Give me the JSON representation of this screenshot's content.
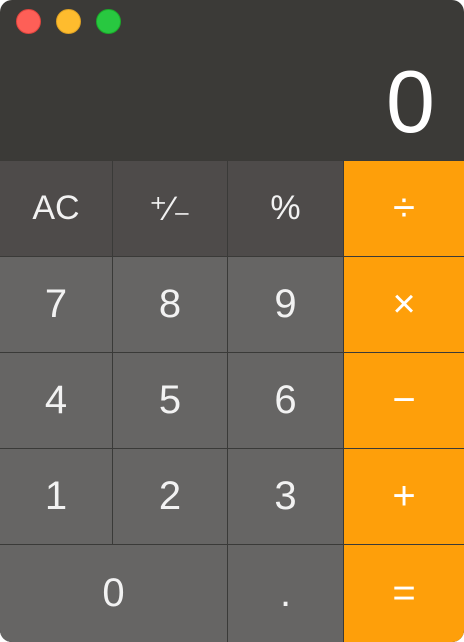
{
  "window": {
    "controls": {
      "close_color": "#fe5f57",
      "minimize_color": "#febc2e",
      "zoom_color": "#28c840"
    }
  },
  "display": {
    "value": "0"
  },
  "keypad": {
    "function_keys": [
      "AC",
      "⁺∕₋",
      "%"
    ],
    "row1_digits": [
      "7",
      "8",
      "9"
    ],
    "row2_digits": [
      "4",
      "5",
      "6"
    ],
    "row3_digits": [
      "1",
      "2",
      "3"
    ],
    "row4": {
      "zero": "0",
      "decimal": "."
    },
    "operators": {
      "divide": "÷",
      "multiply": "×",
      "subtract": "−",
      "add": "+",
      "equals": "="
    }
  },
  "colors": {
    "background": "#3b3a37",
    "function_key": "#4e4b4a",
    "digit_key": "#666564",
    "operator_key": "#fe9f0a"
  }
}
